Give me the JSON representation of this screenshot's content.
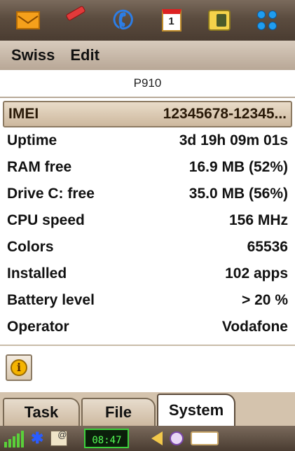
{
  "launcher": {
    "icons": [
      "messaging-icon",
      "contacts-icon",
      "phone-icon",
      "calendar-icon",
      "media-icon",
      "apps-grid-icon"
    ],
    "calendar_day": "1"
  },
  "menu": {
    "items": [
      {
        "label": "Swiss"
      },
      {
        "label": "Edit"
      }
    ]
  },
  "device": {
    "model": "P910"
  },
  "info": {
    "rows": [
      {
        "label": "IMEI",
        "value": "12345678-12345..."
      },
      {
        "label": "Uptime",
        "value": "3d 19h 09m 01s"
      },
      {
        "label": "RAM free",
        "value": "16.9 MB (52%)"
      },
      {
        "label": "Drive C: free",
        "value": "35.0 MB (56%)"
      },
      {
        "label": "CPU speed",
        "value": "156 MHz"
      },
      {
        "label": "Colors",
        "value": "65536"
      },
      {
        "label": "Installed",
        "value": "102 apps"
      },
      {
        "label": "Battery level",
        "value": "> 20 %"
      },
      {
        "label": "Operator",
        "value": "Vodafone"
      }
    ]
  },
  "info_button": {
    "glyph": "i"
  },
  "tabs": [
    {
      "label": "Task"
    },
    {
      "label": "File"
    },
    {
      "label": "System",
      "active": true
    }
  ],
  "status": {
    "time": "08:47",
    "message_glyph": "@"
  }
}
